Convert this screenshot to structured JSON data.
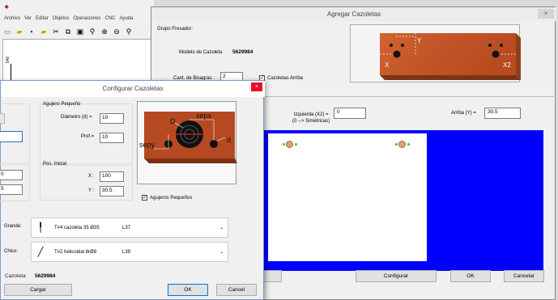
{
  "app": {
    "menu": [
      "Archivo",
      "Ver",
      "Editar",
      "Objetos",
      "Operaciones",
      "CNC",
      "Ayuda"
    ],
    "ruler_label": "540"
  },
  "add_dialog": {
    "title": "Agregar Cazoletas",
    "close": "×",
    "grupo_label": "Grupo Fresador:",
    "modelo_label": "Modelo de Cazoleta",
    "modelo_value": "5629984",
    "cant_label": "Cant. de Bisagras :",
    "cant_value": "2",
    "arriba_check_label": "Cazoletas Arriba",
    "arriba_checked": true,
    "preview_labels": {
      "x": "X",
      "y": "Y",
      "x2": "X2"
    },
    "izq_label_1": "Izquierda (X2) =",
    "izq_label_2": "(0 --> Simétricas)",
    "izq_value": "0",
    "arriba_y_label": "Arriba (Y) =",
    "arriba_y_value": "30.5",
    "buttons": {
      "configurar": "Configurar",
      "ok": "OK",
      "cancelar": "Cancelar"
    },
    "colors": {
      "blue_panel": "#0000ff",
      "wood": "#c8562a"
    }
  },
  "cfg_dialog": {
    "title": "Configurar Cazoletas",
    "close": "×",
    "agujero_title": "Agujero Pequeño",
    "diam_label": "Diámetro (d) =",
    "diam_value": "10",
    "prof_label": "Prof.=",
    "prof_value": "10",
    "left_value_1": "",
    "left_value_2": "0",
    "left_value_3": "5",
    "pos_title": "Pos. Inicial",
    "x_label": "X :",
    "x_value": "100",
    "y_label": "Y :",
    "y_value": "30.5",
    "diagram_labels": {
      "sepx": "sepx",
      "sepy": "sepy",
      "D": "D",
      "d": "d"
    },
    "peq_check_label": "Agujeros Pequeños",
    "peq_checked": true,
    "grande_label": "Grande:",
    "grande_tool": "T#4 cazoleta 35 Ø35",
    "grande_code": "L37",
    "chico_label": "Chico:",
    "chico_tool": "T#2 helicoidal 8rØ8",
    "chico_code": "L39",
    "cazoleta_label": "Cazoleta",
    "cazoleta_value": "5629984",
    "buttons": {
      "cargar": "Cargar",
      "ok": "OK",
      "cancel": "Cancel"
    }
  }
}
